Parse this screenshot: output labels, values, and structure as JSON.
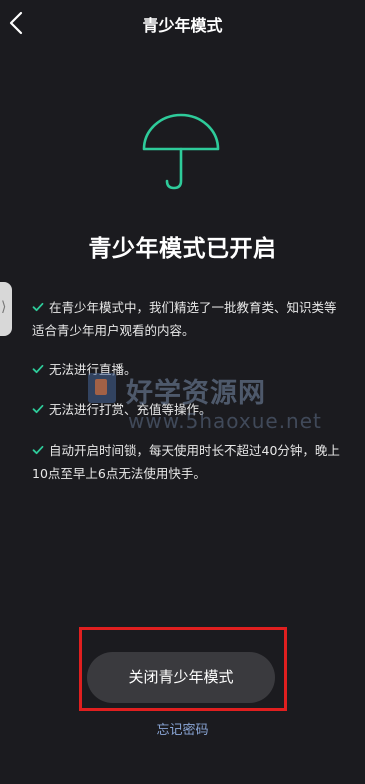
{
  "header": {
    "title": "青少年模式",
    "back_icon": "chevron-left-icon"
  },
  "main": {
    "icon": "umbrella-icon",
    "accent_color": "#2ecb9a",
    "headline": "青少年模式已开启",
    "rules": [
      "在青少年模式中，我们精选了一批教育类、知识类等适合青少年用户观看的内容。",
      "无法进行直播。",
      "无法进行打赏、充值等操作。",
      "自动开启时间锁，每天使用时长不超过40分钟，晚上10点至早上6点无法使用快手。"
    ]
  },
  "watermark": {
    "title": "好学资源网",
    "url": "www.5haoxue.net"
  },
  "side_handle": {
    "glyph": "⟩"
  },
  "footer": {
    "close_button_label": "关闭青少年模式",
    "forgot_password_label": "忘记密码",
    "highlight_color": "#e01f1f"
  }
}
